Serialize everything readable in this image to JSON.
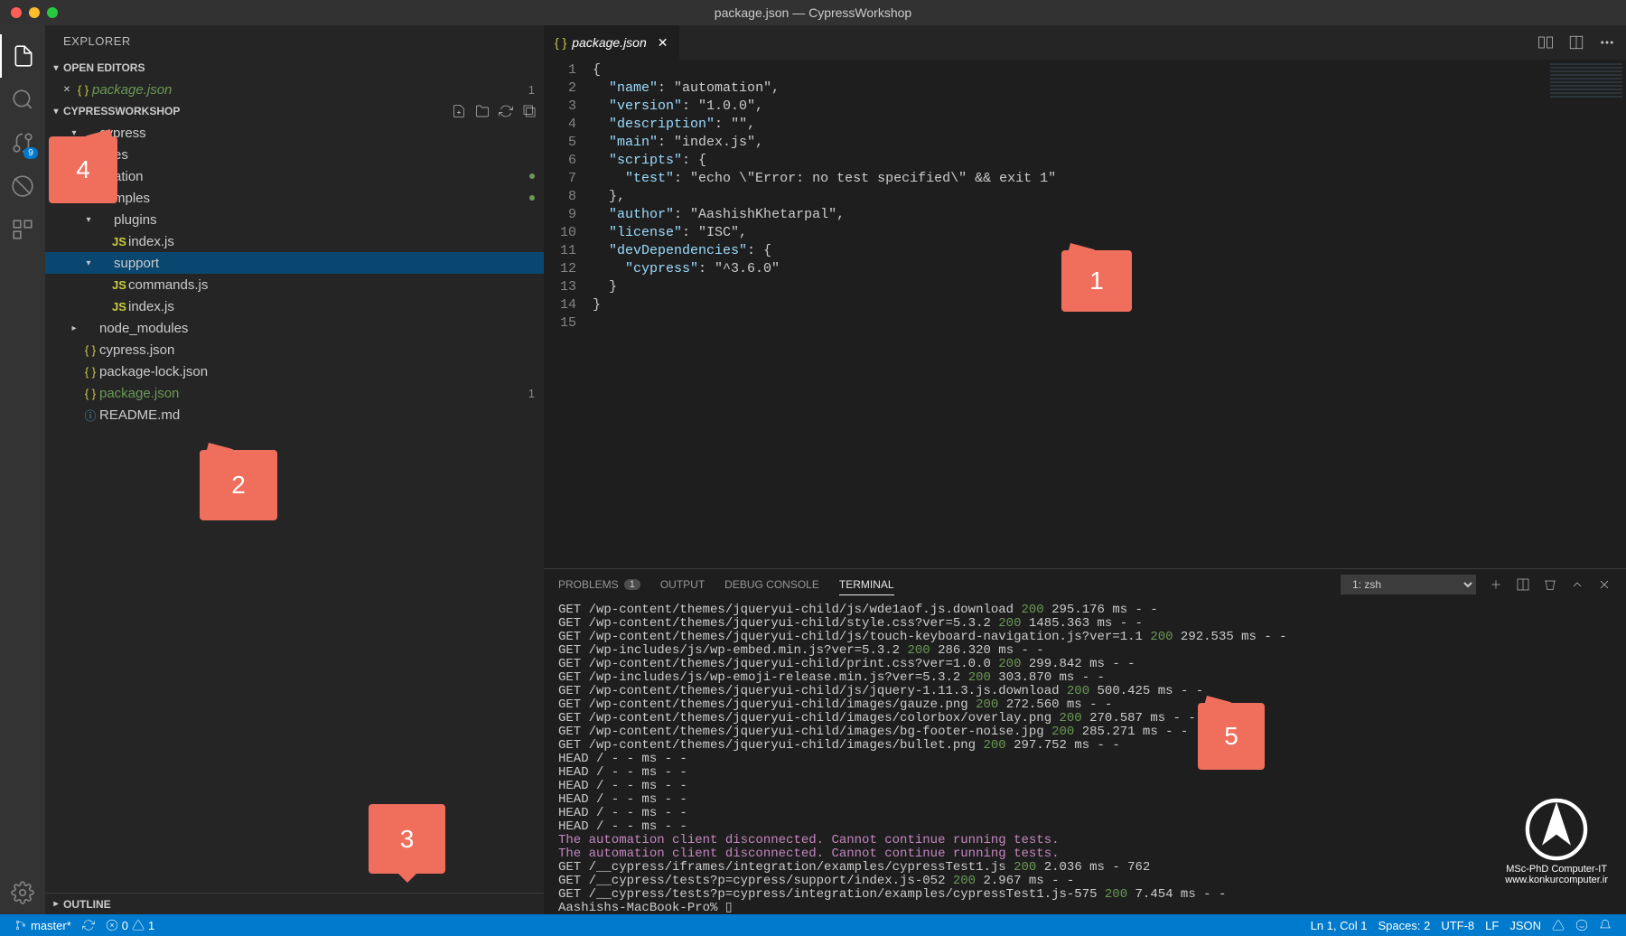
{
  "window": {
    "title": "package.json — CypressWorkshop"
  },
  "activity": {
    "badge_scm": "9"
  },
  "sidebar": {
    "title": "EXPLORER",
    "open_editors_label": "OPEN EDITORS",
    "workspace_label": "CYPRESSWORKSHOP",
    "outline_label": "OUTLINE",
    "open_editors": [
      {
        "label": "package.json",
        "badge": "1"
      }
    ],
    "tree": [
      {
        "label": "cypress",
        "indent": 1,
        "chev": "down",
        "type": "folder"
      },
      {
        "label": "es",
        "indent": 2,
        "chev": "none",
        "type": "folder-partial"
      },
      {
        "label": "ation",
        "indent": 2,
        "chev": "none",
        "type": "folder-partial",
        "dot": true
      },
      {
        "label": "mples",
        "indent": 2,
        "chev": "none",
        "type": "folder-partial",
        "dot": true
      },
      {
        "label": "plugins",
        "indent": 2,
        "chev": "down",
        "type": "folder"
      },
      {
        "label": "index.js",
        "indent": 3,
        "chev": "none",
        "type": "js"
      },
      {
        "label": "support",
        "indent": 2,
        "chev": "down",
        "type": "folder",
        "selected": true
      },
      {
        "label": "commands.js",
        "indent": 3,
        "chev": "none",
        "type": "js"
      },
      {
        "label": "index.js",
        "indent": 3,
        "chev": "none",
        "type": "js"
      },
      {
        "label": "node_modules",
        "indent": 1,
        "chev": "right",
        "type": "folder"
      },
      {
        "label": "cypress.json",
        "indent": 1,
        "chev": "none",
        "type": "json"
      },
      {
        "label": "package-lock.json",
        "indent": 1,
        "chev": "none",
        "type": "json"
      },
      {
        "label": "package.json",
        "indent": 1,
        "chev": "none",
        "type": "json",
        "green": true,
        "badge": "1"
      },
      {
        "label": "README.md",
        "indent": 1,
        "chev": "none",
        "type": "info"
      }
    ]
  },
  "editor": {
    "tab_label": "package.json",
    "lines": [
      "{",
      "  \"name\": \"automation\",",
      "  \"version\": \"1.0.0\",",
      "  \"description\": \"\",",
      "  \"main\": \"index.js\",",
      "  \"scripts\": {",
      "    \"test\": \"echo \\\"Error: no test specified\\\" && exit 1\"",
      "  },",
      "  \"author\": \"AashishKhetarpal\",",
      "  \"license\": \"ISC\",",
      "  \"devDependencies\": {",
      "    \"cypress\": \"^3.6.0\"",
      "  }",
      "}",
      ""
    ]
  },
  "panel": {
    "tabs": {
      "problems": "PROBLEMS",
      "problems_count": "1",
      "output": "OUTPUT",
      "debug": "DEBUG CONSOLE",
      "terminal": "TERMINAL"
    },
    "shell_label": "1: zsh",
    "terminal_lines": [
      [
        "GET /wp-content/themes/jqueryui-child/js/wde1aof.js.download ",
        "200",
        " 295.176 ms - -"
      ],
      [
        "GET /wp-content/themes/jqueryui-child/style.css?ver=5.3.2 ",
        "200",
        " 1485.363 ms - -"
      ],
      [
        "GET /wp-content/themes/jqueryui-child/js/touch-keyboard-navigation.js?ver=1.1 ",
        "200",
        " 292.535 ms - -"
      ],
      [
        "GET /wp-includes/js/wp-embed.min.js?ver=5.3.2 ",
        "200",
        " 286.320 ms - -"
      ],
      [
        "GET /wp-content/themes/jqueryui-child/print.css?ver=1.0.0 ",
        "200",
        " 299.842 ms - -"
      ],
      [
        "GET /wp-includes/js/wp-emoji-release.min.js?ver=5.3.2 ",
        "200",
        " 303.870 ms - -"
      ],
      [
        "GET /wp-content/themes/jqueryui-child/js/jquery-1.11.3.js.download ",
        "200",
        " 500.425 ms - -"
      ],
      [
        "GET /wp-content/themes/jqueryui-child/images/gauze.png ",
        "200",
        " 272.560 ms - -"
      ],
      [
        "GET /wp-content/themes/jqueryui-child/images/colorbox/overlay.png ",
        "200",
        " 270.587 ms - -"
      ],
      [
        "GET /wp-content/themes/jqueryui-child/images/bg-footer-noise.jpg ",
        "200",
        " 285.271 ms - -"
      ],
      [
        "GET /wp-content/themes/jqueryui-child/images/bullet.png ",
        "200",
        " 297.752 ms - -"
      ],
      [
        "HEAD / - - ms - -",
        "",
        ""
      ],
      [
        "HEAD / - - ms - -",
        "",
        ""
      ],
      [
        "HEAD / - - ms - -",
        "",
        ""
      ],
      [
        "HEAD / - - ms - -",
        "",
        ""
      ],
      [
        "HEAD / - - ms - -",
        "",
        ""
      ],
      [
        "HEAD / - - ms - -",
        "",
        ""
      ],
      [
        "PURPLE",
        "The automation client disconnected. Cannot continue running tests.",
        ""
      ],
      [
        "PURPLE",
        "The automation client disconnected. Cannot continue running tests.",
        ""
      ],
      [
        "GET /__cypress/iframes/integration/examples/cypressTest1.js ",
        "200",
        " 2.036 ms - 762"
      ],
      [
        "GET /__cypress/tests?p=cypress/support/index.js-052 ",
        "200",
        " 2.967 ms - -"
      ],
      [
        "GET /__cypress/tests?p=cypress/integration/examples/cypressTest1.js-575 ",
        "200",
        " 7.454 ms - -"
      ],
      [
        "Aashishs-MacBook-Pro% ▯",
        "",
        ""
      ]
    ]
  },
  "statusbar": {
    "branch": "master*",
    "errors": "0",
    "warnings": "1",
    "ln_col": "Ln 1, Col 1",
    "spaces": "Spaces: 2",
    "encoding": "UTF-8",
    "eol": "LF",
    "lang": "JSON"
  },
  "callouts": {
    "c1": "1",
    "c2": "2",
    "c3": "3",
    "c4": "4",
    "c5": "5"
  },
  "watermark": {
    "line1": "MSc-PhD Computer-IT",
    "line2": "www.konkurcomputer.ir"
  }
}
